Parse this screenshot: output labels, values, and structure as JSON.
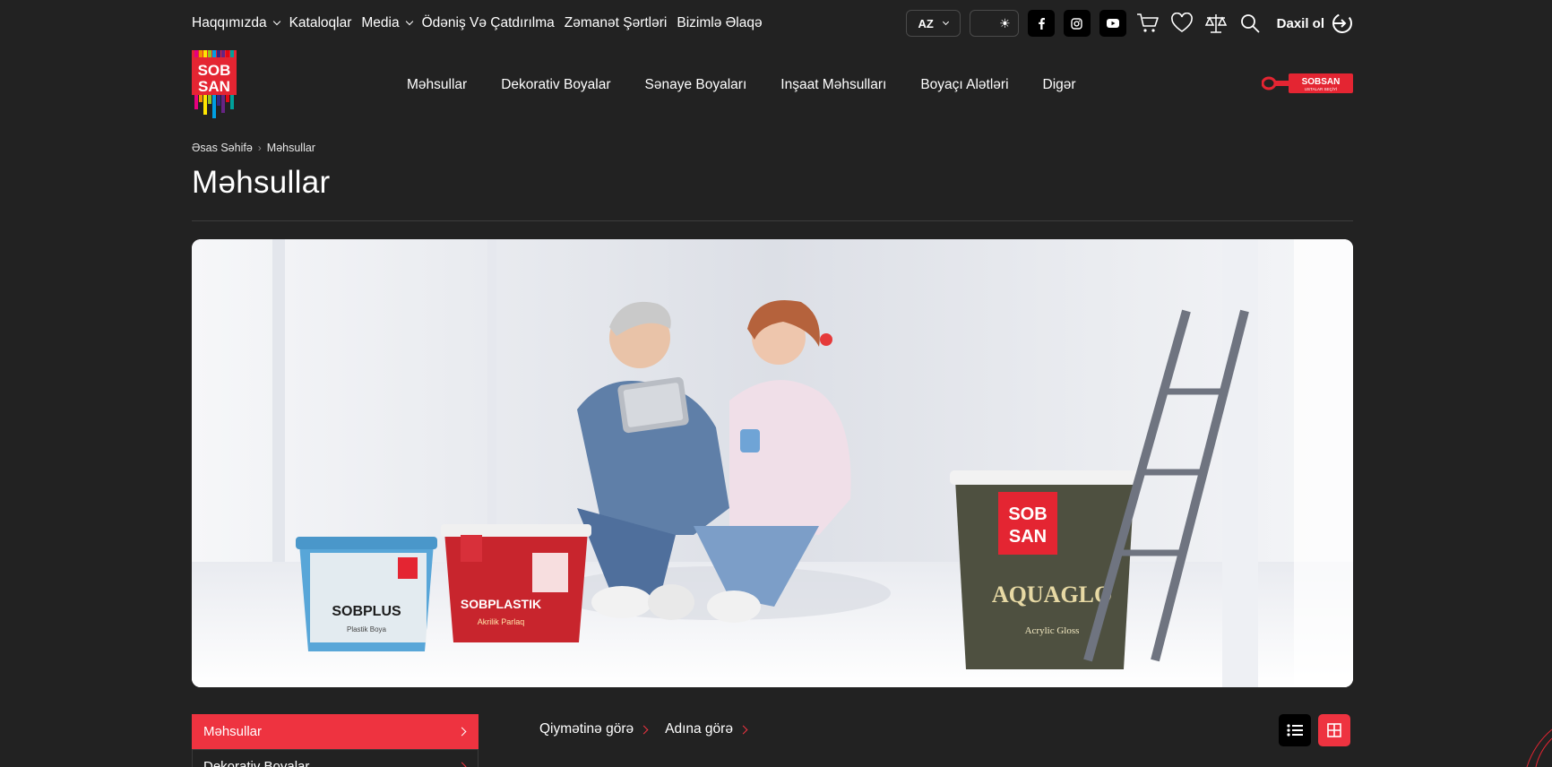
{
  "topbar": {
    "links": [
      {
        "label": "Haqqımızda",
        "has_dropdown": true
      },
      {
        "label": "Kataloqlar",
        "has_dropdown": false
      },
      {
        "label": "Media",
        "has_dropdown": true
      },
      {
        "label": "Ödəniş Və Çatdırılma",
        "has_dropdown": false
      },
      {
        "label": "Zəmanət Şərtləri",
        "has_dropdown": false
      },
      {
        "label": "Bizimlə Əlaqə",
        "has_dropdown": false
      }
    ],
    "language": "AZ",
    "theme_icon": "sun-icon",
    "social": [
      "facebook-icon",
      "instagram-icon",
      "youtube-icon"
    ],
    "icons": [
      "cart-icon",
      "heart-icon",
      "compare-icon",
      "search-icon"
    ],
    "login_label": "Daxil ol"
  },
  "header": {
    "logo_text": [
      "SOB",
      "SAN"
    ],
    "nav": [
      "Məhsullar",
      "Dekorativ Boyalar",
      "Sənaye Boyaları",
      "Inşaat Məhsulları",
      "Boyaçı Alətləri",
      "Digər"
    ],
    "brush_logo_text": "SOBSAN",
    "brush_logo_subtext": "USTALAR SEÇİYİ"
  },
  "breadcrumb": {
    "home": "Əsas Səhifə",
    "current": "Məhsullar"
  },
  "page_title": "Məhsullar",
  "banner": {
    "buckets": [
      "SOBPLUS",
      "SOBPLASTIK",
      "AQUAGLO"
    ],
    "bucket_subtitles": [
      "Plastik Boya",
      "Akrilik Parlaq",
      "Acrylic Gloss"
    ]
  },
  "sidebar": {
    "items": [
      {
        "label": "Məhsullar",
        "active": true
      },
      {
        "label": "Dekorativ Boyalar",
        "active": false
      }
    ]
  },
  "sorting": {
    "by_price": "Qiymətinə görə",
    "by_name": "Adına görə"
  },
  "views": [
    "list-view-icon",
    "grid-view-icon"
  ],
  "colors": {
    "accent": "#ee3340",
    "background": "#222222",
    "text": "#ffffff"
  }
}
